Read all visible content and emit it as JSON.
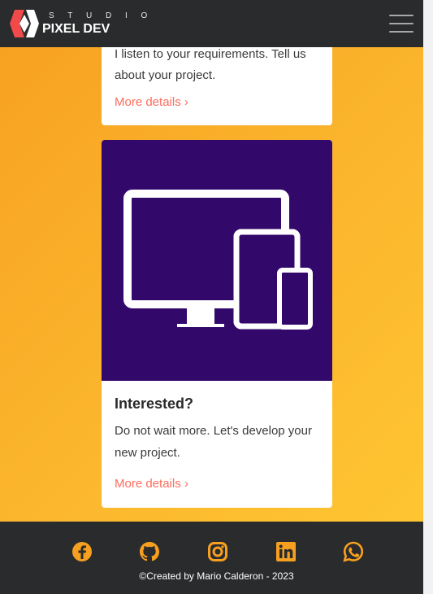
{
  "navbar": {
    "brand_top": "S T U D I O",
    "brand_name": "PIXEL DEV",
    "menu_icon": "hamburger-icon"
  },
  "cards": [
    {
      "text": "I listen to your requirements. Tell us about your project.",
      "link": "More details ›"
    },
    {
      "image": "devices-icon",
      "title": "Interested?",
      "text": "Do not wait more. Let's develop your new project.",
      "link": "More details ›"
    }
  ],
  "footer": {
    "social": [
      "facebook-icon",
      "github-icon",
      "instagram-icon",
      "linkedin-icon",
      "whatsapp-icon"
    ],
    "copyright": "©Created by Mario Calderon - 2023"
  },
  "colors": {
    "accent": "#ff6b5b",
    "footer_icon": "#f7a020",
    "card_image_bg": "#33086b",
    "navbar_bg": "#2a2b2c"
  }
}
